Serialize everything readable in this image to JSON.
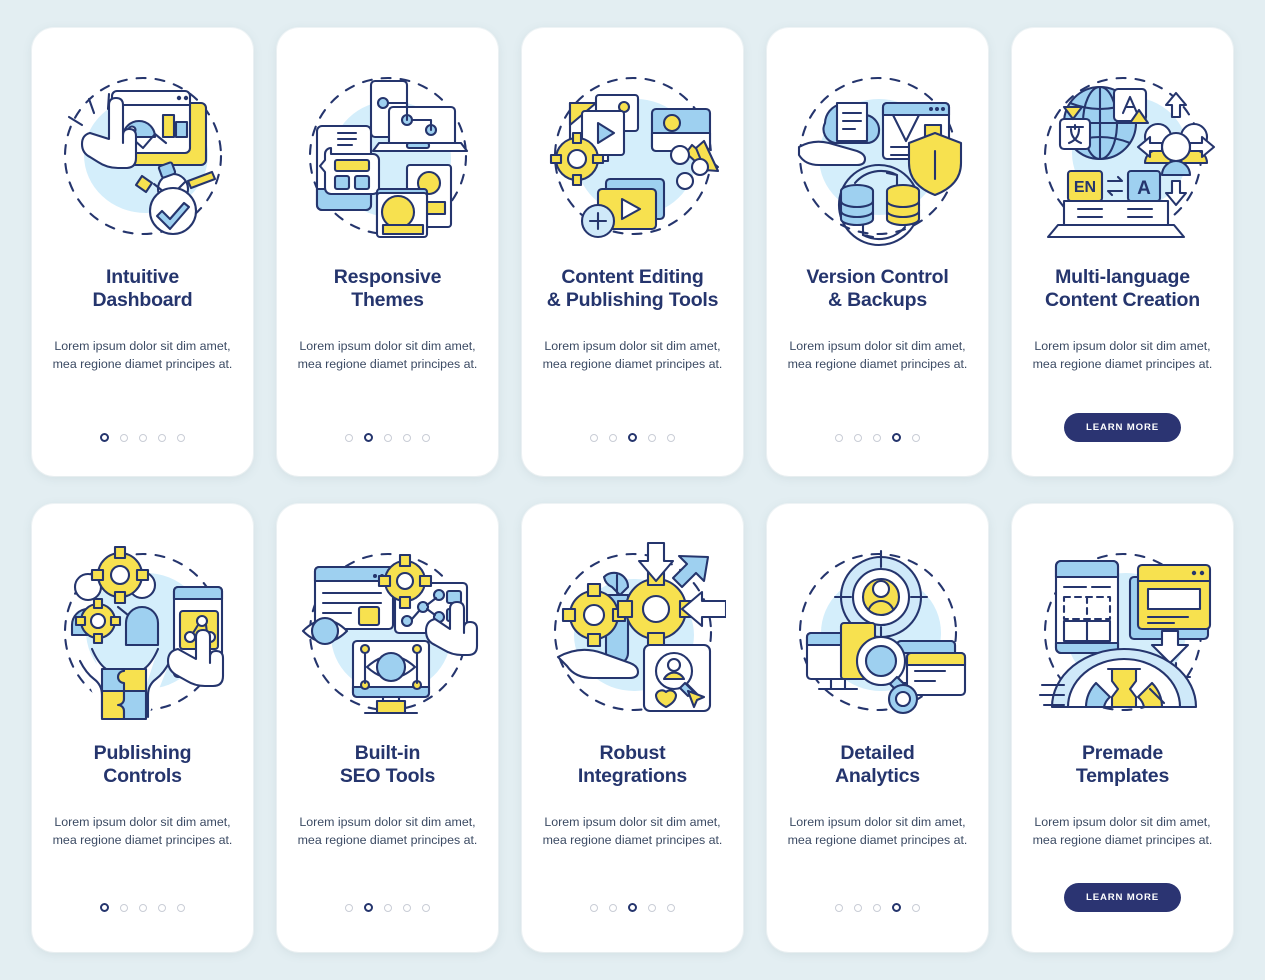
{
  "page": {
    "background_color": "#e3eef2",
    "card_background": "#ffffff",
    "title_color": "#25356d",
    "accent_yellow": "#f7e14f",
    "accent_blue": "#9ed0f0",
    "cta_color": "#2b3472"
  },
  "body_text": "Lorem ipsum dolor sit dim amet, mea regione diamet principes at.",
  "cta_label": "LEARN MORE",
  "screens": [
    {
      "id": "intuitive-dashboard",
      "title": "Intuitive\nDashboard",
      "body": "Lorem ipsum dolor sit dim amet, mea regione diamet principes at.",
      "dots_total": 5,
      "active_dot": 1,
      "has_cta": false,
      "icon": "dashboard-cursor-illustration"
    },
    {
      "id": "responsive-themes",
      "title": "Responsive\nThemes",
      "body": "Lorem ipsum dolor sit dim amet, mea regione diamet principes at.",
      "dots_total": 5,
      "active_dot": 2,
      "has_cta": false,
      "icon": "responsive-devices-illustration"
    },
    {
      "id": "content-editing",
      "title": "Content Editing\n& Publishing Tools",
      "body": "Lorem ipsum dolor sit dim amet, mea regione diamet principes at.",
      "dots_total": 5,
      "active_dot": 3,
      "has_cta": false,
      "icon": "media-editing-illustration"
    },
    {
      "id": "version-control",
      "title": "Version Control\n& Backups",
      "body": "Lorem ipsum dolor sit dim amet, mea regione diamet principes at.",
      "dots_total": 5,
      "active_dot": 4,
      "has_cta": false,
      "icon": "cloud-backup-shield-illustration"
    },
    {
      "id": "multi-language",
      "title": "Multi-language\nContent Creation",
      "body": "Lorem ipsum dolor sit dim amet, mea regione diamet principes at.",
      "dots_total": 0,
      "active_dot": 0,
      "has_cta": true,
      "cta_label": "LEARN MORE",
      "icon": "globe-translate-illustration"
    },
    {
      "id": "publishing-controls",
      "title": "Publishing\nControls",
      "body": "Lorem ipsum dolor sit dim amet, mea regione diamet principes at.",
      "dots_total": 5,
      "active_dot": 1,
      "has_cta": false,
      "icon": "team-gears-puzzle-illustration"
    },
    {
      "id": "builtin-seo-tools",
      "title": "Built-in\nSEO Tools",
      "body": "Lorem ipsum dolor sit dim amet, mea regione diamet principes at.",
      "dots_total": 5,
      "active_dot": 2,
      "has_cta": false,
      "icon": "seo-eye-monitor-illustration"
    },
    {
      "id": "robust-integrations",
      "title": "Robust\nIntegrations",
      "body": "Lorem ipsum dolor sit dim amet, mea regione diamet principes at.",
      "dots_total": 5,
      "active_dot": 3,
      "has_cta": false,
      "icon": "wrench-gears-arrows-illustration"
    },
    {
      "id": "detailed-analytics",
      "title": "Detailed\nAnalytics",
      "body": "Lorem ipsum dolor sit dim amet, mea regione diamet principes at.",
      "dots_total": 5,
      "active_dot": 4,
      "has_cta": false,
      "icon": "analytics-target-devices-illustration"
    },
    {
      "id": "premade-templates",
      "title": "Premade\nTemplates",
      "body": "Lorem ipsum dolor sit dim amet, mea regione diamet principes at.",
      "dots_total": 0,
      "active_dot": 0,
      "has_cta": true,
      "cta_label": "LEARN MORE",
      "icon": "templates-download-illustration"
    }
  ]
}
